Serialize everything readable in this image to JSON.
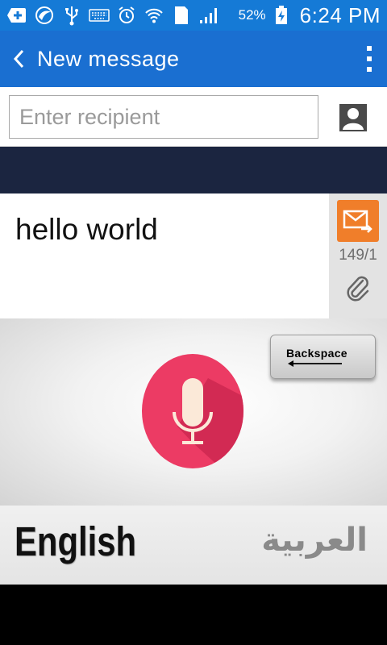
{
  "status_bar": {
    "battery_percent": "52%",
    "time": "6:24 PM",
    "sim_slot": "1",
    "icons": [
      "add-icon",
      "browser-icon",
      "usb-icon",
      "keyboard-icon",
      "alarm-icon",
      "wifi-icon",
      "sim-icon",
      "signal-icon",
      "battery-charging-icon"
    ]
  },
  "action_bar": {
    "title": "New message",
    "back_icon": "chevron-left-icon",
    "menu_icon": "overflow-menu-icon",
    "color": "#1a6fd1"
  },
  "recipient": {
    "placeholder": "Enter recipient",
    "value": "",
    "contact_icon": "contact-icon"
  },
  "compose": {
    "text": "hello world",
    "char_count": "149/1",
    "send_icon": "send-message-icon",
    "attach_icon": "paperclip-icon",
    "send_color": "#f07e2a"
  },
  "keyboard": {
    "backspace_label": "Backspace",
    "mic_icon": "microphone-icon",
    "mic_color": "#ec3b64"
  },
  "languages": {
    "english": "English",
    "arabic": "العربية"
  }
}
